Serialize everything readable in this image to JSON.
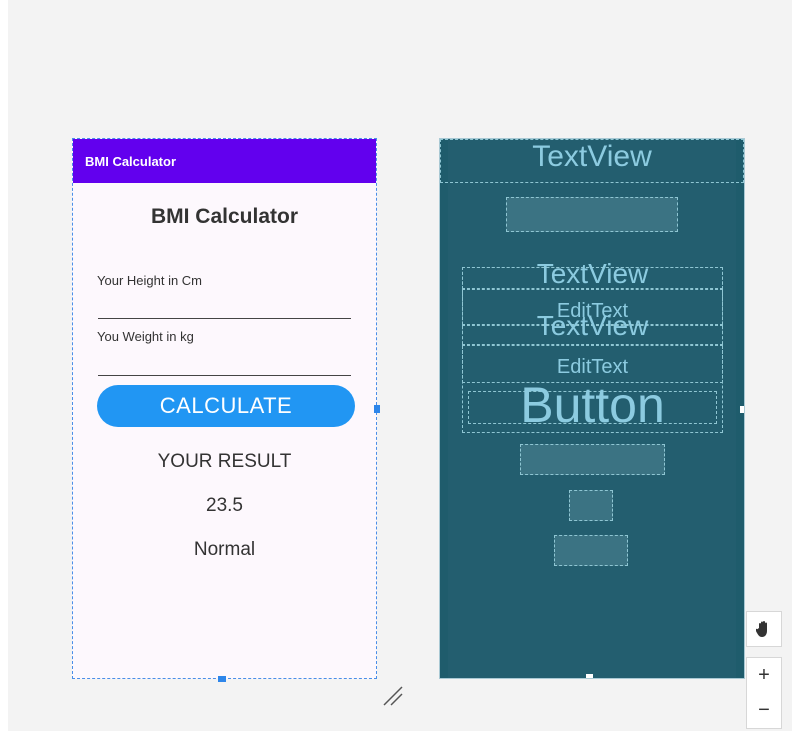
{
  "design": {
    "appbar_title": "BMI Calculator",
    "title": "BMI Calculator",
    "height_label": "Your Height in Cm",
    "weight_label": "You Weight in kg",
    "calculate_label": "CALCULATE",
    "result_label": "YOUR RESULT",
    "result_value": "23.5",
    "result_category": "Normal"
  },
  "blueprint": {
    "top_textview": "TextView",
    "textview_1": "TextView",
    "edittext_1": "EditText",
    "textview_2": "TextView",
    "edittext_2": "EditText",
    "button": "Button"
  },
  "controls": {
    "zoom_in": "+",
    "zoom_out": "−"
  },
  "colors": {
    "appbar": "#6200ee",
    "button": "#2196f3",
    "blueprint_bg": "#1f5c6c",
    "blueprint_text": "#8ccbe0"
  },
  "icons": {
    "pan": "hand-icon",
    "resize": "resize-handle-icon"
  }
}
